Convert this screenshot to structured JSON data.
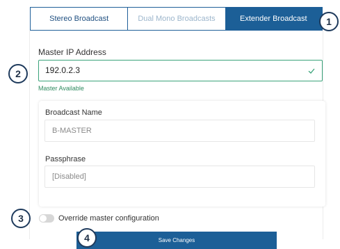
{
  "tabs": [
    {
      "label": "Stereo Broadcast",
      "state": "default"
    },
    {
      "label": "Dual Mono Broadcasts",
      "state": "disabled"
    },
    {
      "label": "Extender Broadcast",
      "state": "selected"
    }
  ],
  "master_ip": {
    "label": "Master IP Address",
    "value": "192.0.2.3",
    "status": "Master Available"
  },
  "broadcast_name": {
    "label": "Broadcast Name",
    "value": "B-MASTER"
  },
  "passphrase": {
    "label": "Passphrase",
    "value": "[Disabled]"
  },
  "override": {
    "label": "Override master configuration",
    "checked": false
  },
  "save_button": {
    "label": "Save Changes"
  },
  "markers": [
    "1",
    "2",
    "3",
    "4"
  ],
  "colors": {
    "primary": "#1c5f97",
    "success": "#3aa37a",
    "success_text": "#2e8a5f",
    "marker_border": "#1e3a5c"
  }
}
